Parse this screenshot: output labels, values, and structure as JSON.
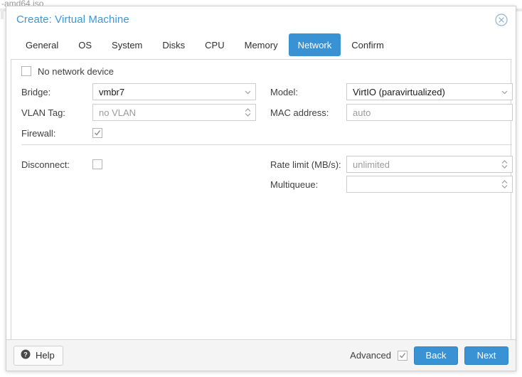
{
  "background": {
    "text": "-amd64.iso"
  },
  "dialog": {
    "title": "Create: Virtual Machine",
    "close_icon": "close-circle-icon"
  },
  "tabs": [
    {
      "label": "General",
      "active": false
    },
    {
      "label": "OS",
      "active": false
    },
    {
      "label": "System",
      "active": false
    },
    {
      "label": "Disks",
      "active": false
    },
    {
      "label": "CPU",
      "active": false
    },
    {
      "label": "Memory",
      "active": false
    },
    {
      "label": "Network",
      "active": true
    },
    {
      "label": "Confirm",
      "active": false
    }
  ],
  "form": {
    "no_network_device": {
      "label": "No network device",
      "checked": false
    },
    "bridge": {
      "label": "Bridge:",
      "value": "vmbr7",
      "is_placeholder": false,
      "trigger": "chevron-down-icon"
    },
    "vlan_tag": {
      "label": "VLAN Tag:",
      "value": "no VLAN",
      "is_placeholder": true,
      "trigger": "spinner-icon"
    },
    "firewall": {
      "label": "Firewall:",
      "checked": true
    },
    "model": {
      "label": "Model:",
      "value": "VirtIO (paravirtualized)",
      "is_placeholder": false,
      "trigger": "chevron-down-icon"
    },
    "mac_address": {
      "label": "MAC address:",
      "value": "auto",
      "is_placeholder": true
    },
    "disconnect": {
      "label": "Disconnect:",
      "checked": false
    },
    "rate_limit": {
      "label": "Rate limit (MB/s):",
      "value": "unlimited",
      "is_placeholder": true,
      "trigger": "spinner-icon"
    },
    "multiqueue": {
      "label": "Multiqueue:",
      "value": "",
      "is_placeholder": true,
      "trigger": "spinner-icon"
    }
  },
  "footer": {
    "help_label": "Help",
    "help_icon": "question-mark-icon",
    "advanced_label": "Advanced",
    "advanced_checked": true,
    "back_label": "Back",
    "next_label": "Next"
  },
  "colors": {
    "accent": "#3892d4",
    "title": "#3b97d5",
    "field_border": "#cccccc",
    "placeholder": "#9b9b9b"
  }
}
